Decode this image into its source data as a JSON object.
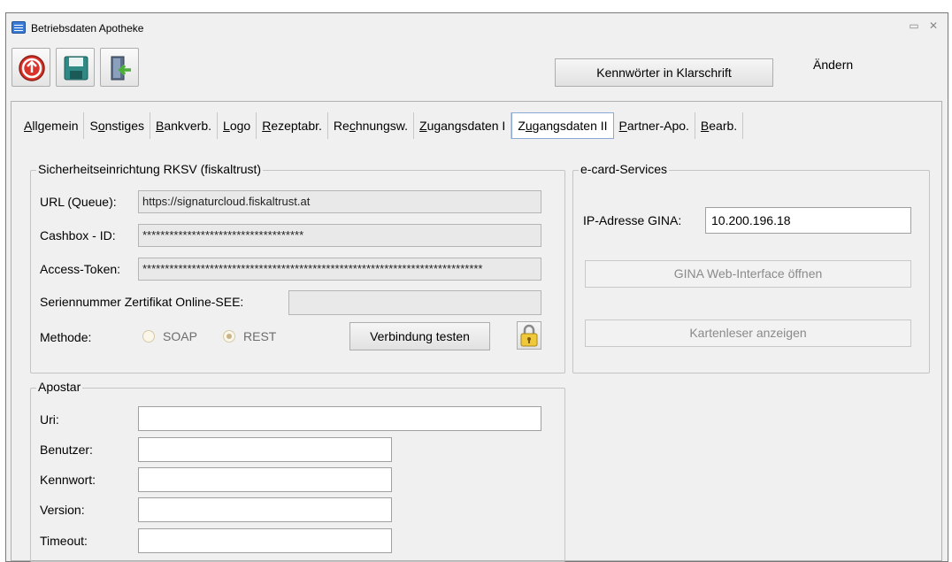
{
  "window": {
    "title": "Betriebsdaten Apotheke",
    "minimize_glyph": "▭",
    "close_glyph": "✕"
  },
  "toolbar": {
    "icons": [
      "exit-icon",
      "save-icon",
      "logout-icon"
    ],
    "passwords_button": "Kennwörter in Klarschrift",
    "mode_label": "Ändern"
  },
  "tabs": [
    {
      "prefix": "",
      "accel": "A",
      "rest": "llgemein"
    },
    {
      "prefix": "S",
      "accel": "o",
      "rest": "nstiges"
    },
    {
      "prefix": "",
      "accel": "B",
      "rest": "ankverb."
    },
    {
      "prefix": "",
      "accel": "L",
      "rest": "ogo"
    },
    {
      "prefix": "",
      "accel": "R",
      "rest": "ezeptabr."
    },
    {
      "prefix": "Re",
      "accel": "c",
      "rest": "hnungsw."
    },
    {
      "prefix": "",
      "accel": "Z",
      "rest": "ugangsdaten I"
    },
    {
      "prefix": "Z",
      "accel": "u",
      "rest": "gangsdaten II"
    },
    {
      "prefix": "",
      "accel": "P",
      "rest": "artner-Apo."
    },
    {
      "prefix": "",
      "accel": "B",
      "rest": "earb."
    }
  ],
  "rksv": {
    "title": "Sicherheitseinrichtung RKSV (fiskaltrust)",
    "url_label": "URL (Queue):",
    "url_value": "https://signaturcloud.fiskaltrust.at",
    "cashbox_label": "Cashbox - ID:",
    "cashbox_value": "************************************",
    "token_label": "Access-Token:",
    "token_value": "****************************************************************************",
    "serial_label": "Seriennummer Zertifikat Online-SEE:",
    "serial_value": "",
    "method_label": "Methode:",
    "method_options": [
      "SOAP",
      "REST"
    ],
    "method_selected": "REST",
    "test_button": "Verbindung testen"
  },
  "apostar": {
    "title": "Apostar",
    "uri_label": "Uri:",
    "user_label": "Benutzer:",
    "password_label": "Kennwort:",
    "version_label": "Version:",
    "timeout_label": "Timeout:"
  },
  "ecard": {
    "title": "e-card-Services",
    "ip_label": "IP-Adresse GINA:",
    "ip_value": "10.200.196.18",
    "gina_button": "GINA Web-Interface öffnen",
    "reader_button": "Kartenleser anzeigen"
  },
  "colors": {
    "accent": "#3a7bd5",
    "active_tab_border": "#8aa9d6",
    "exit_red": "#d9342b",
    "save_teal": "#2f8a86",
    "logout_green": "#4caf3a"
  }
}
